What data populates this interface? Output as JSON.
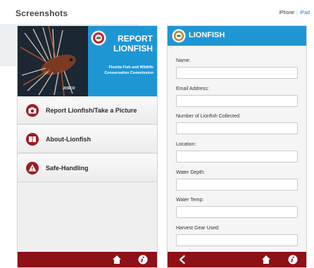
{
  "header": {
    "title": "Screenshots",
    "iphone_label": "iPhone",
    "separator": "|",
    "ipad_label": "iPad"
  },
  "left_app": {
    "banner": {
      "title_line1": "REPORT",
      "title_line2": "LIONFISH",
      "org_line1": "Florida Fish and Wildlife",
      "org_line2": "Conservation Commission",
      "photo_credit": "JOSCO"
    },
    "menu": [
      {
        "label": "Report Lionfish/Take a Picture",
        "icon": "camera-icon"
      },
      {
        "label": "About-Lionfish",
        "icon": "book-icon"
      },
      {
        "label": "Safe-Handling",
        "icon": "warning-icon"
      }
    ],
    "bottom_bar": {
      "icons": [
        "home-icon",
        "info-icon"
      ]
    }
  },
  "right_app": {
    "title": "LIONFISH",
    "fields": [
      {
        "label": "Name:",
        "value": ""
      },
      {
        "label": "Email Address:",
        "value": ""
      },
      {
        "label": "Number of Lionfish Collected:",
        "value": ""
      },
      {
        "label": "Location:",
        "value": ""
      },
      {
        "label": "Water Depth:",
        "value": ""
      },
      {
        "label": "Water Temp:",
        "value": ""
      },
      {
        "label": "Harvest Gear Used:",
        "value": ""
      }
    ],
    "bottom_bar": {
      "icons": [
        "back-icon",
        "home-icon",
        "info-icon"
      ]
    }
  },
  "colors": {
    "accent_blue": "#1f96d4",
    "bar_red": "#8d1117",
    "icon_red": "#9f1b20"
  }
}
